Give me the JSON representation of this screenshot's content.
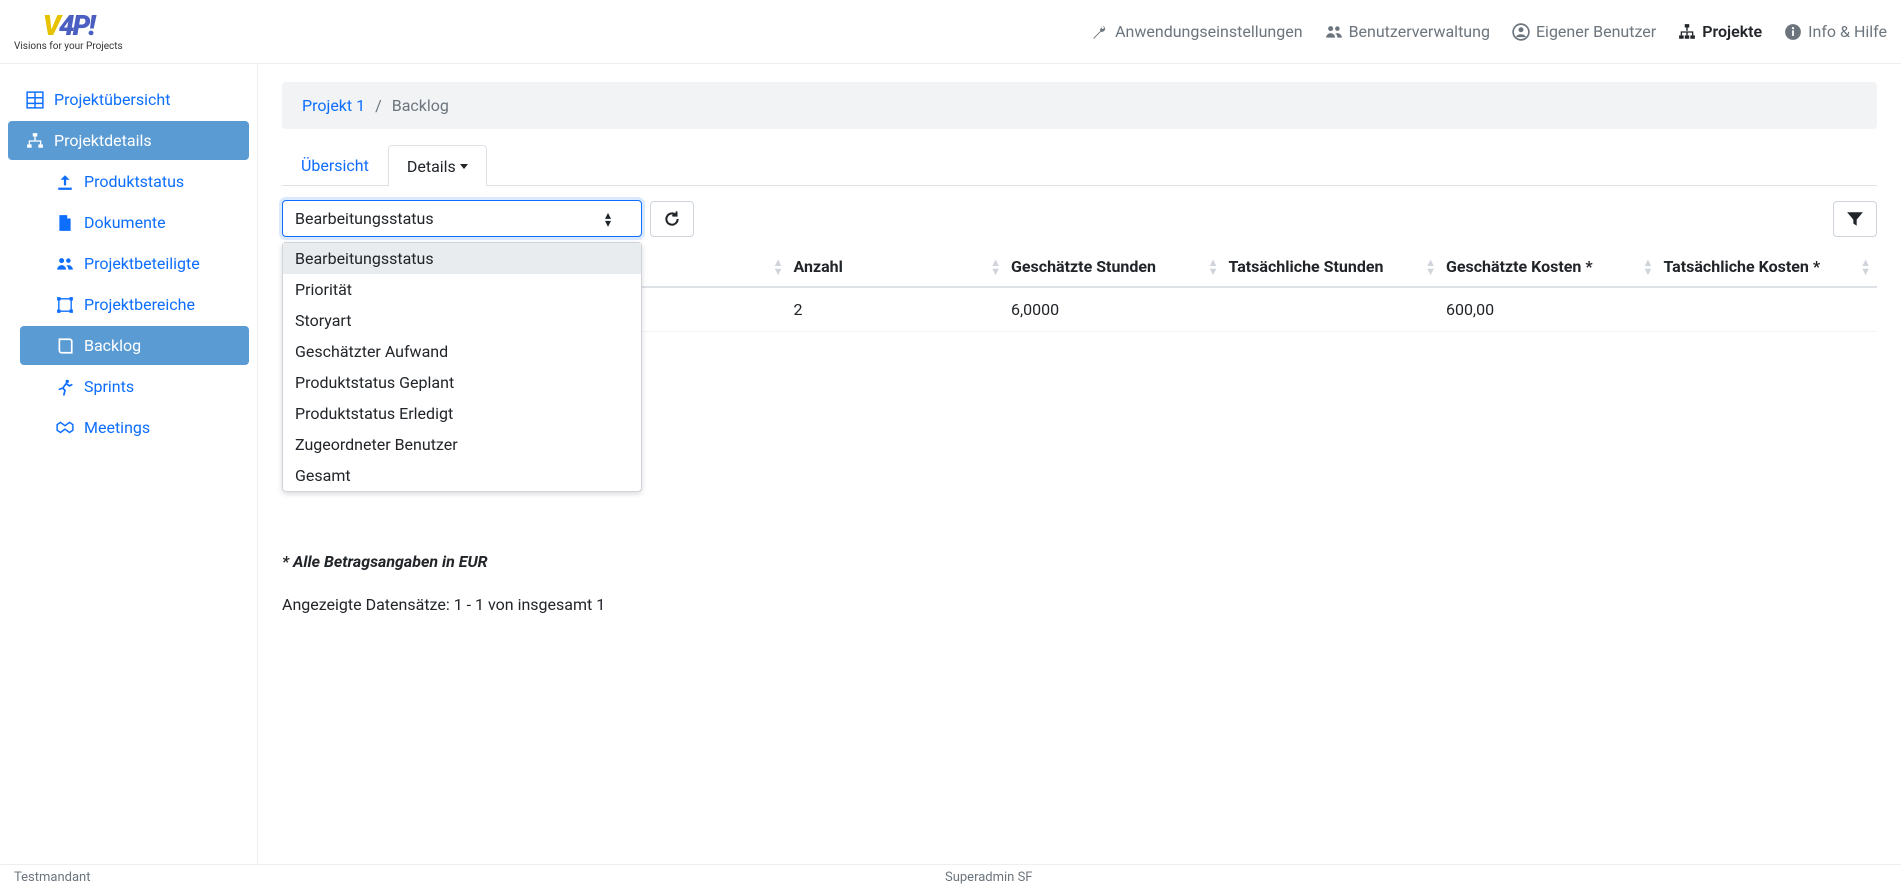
{
  "logo": {
    "subtitle": "Visions for your Projects"
  },
  "topnav": {
    "settings": "Anwendungseinstellungen",
    "users": "Benutzerverwaltung",
    "own_user": "Eigener Benutzer",
    "projects": "Projekte",
    "help": "Info & Hilfe"
  },
  "sidebar": {
    "overview": "Projektübersicht",
    "details": "Projektdetails",
    "product_status": "Produktstatus",
    "documents": "Dokumente",
    "participants": "Projektbeteiligte",
    "areas": "Projektbereiche",
    "backlog": "Backlog",
    "sprints": "Sprints",
    "meetings": "Meetings"
  },
  "breadcrumb": {
    "project": "Projekt 1",
    "current": "Backlog"
  },
  "tabs": {
    "overview": "Übersicht",
    "details": "Details"
  },
  "select": {
    "value": "Bearbeitungsstatus",
    "options": [
      "Bearbeitungsstatus",
      "Priorität",
      "Storyart",
      "Geschätzter Aufwand",
      "Produktstatus Geplant",
      "Produktstatus Erledigt",
      "Zugeordneter Benutzer",
      "Gesamt"
    ]
  },
  "table": {
    "headers": {
      "col1": "",
      "anzahl": "Anzahl",
      "est_hours": "Geschätzte Stunden",
      "act_hours": "Tatsächliche Stunden",
      "est_cost": "Geschätzte Kosten *",
      "act_cost": "Tatsächliche Kosten *"
    },
    "rows": [
      {
        "anzahl": "2",
        "est_hours": "6,0000",
        "act_hours": "",
        "est_cost": "600,00",
        "act_cost": ""
      }
    ]
  },
  "footnote": "* Alle Betragsangaben in EUR",
  "record_count": "Angezeigte Datensätze: 1 - 1 von insgesamt 1",
  "footer": {
    "tenant": "Testmandant",
    "user": "Superadmin SF"
  }
}
